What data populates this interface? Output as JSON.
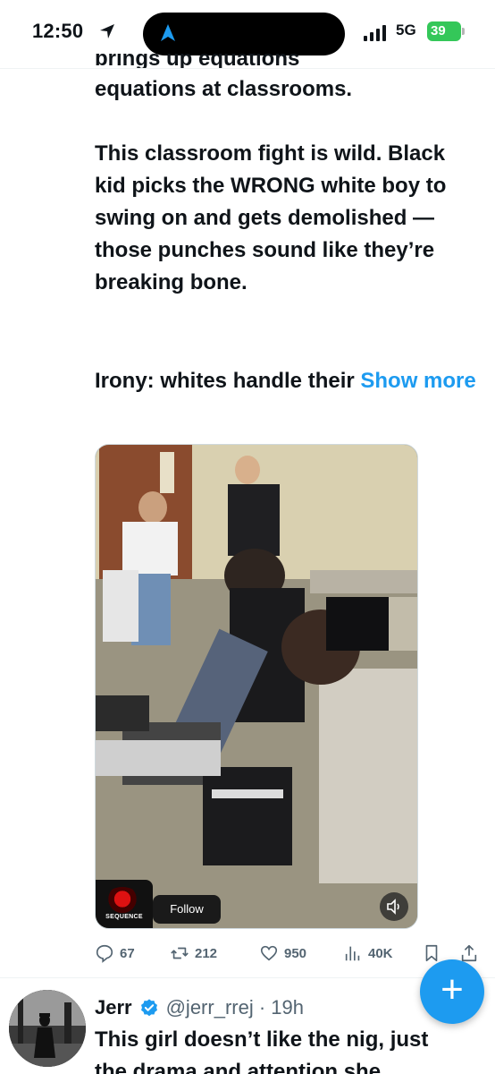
{
  "status_bar": {
    "time": "12:50",
    "network": "5G",
    "battery": "39"
  },
  "tweet": {
    "cut_line": "brings up equations",
    "paragraph1": "equations at classrooms.",
    "paragraph2": "This classroom fight is wild. Black kid picks the WRONG white boy to swing on and gets demolished — those punches sound like they’re breaking bone.",
    "paragraph3_start": "Irony: whites handle their ",
    "show_more": "Show more",
    "video": {
      "channel_name": "SEQUENCE",
      "follow_label": "Follow"
    },
    "actions": {
      "replies": "67",
      "reposts": "212",
      "likes": "950",
      "views": "40K"
    }
  },
  "next_tweet": {
    "name": "Jerr",
    "handle_time": "@jerr_rrej · 19h",
    "text_line1": "This girl doesn’t like the nig, just",
    "text_line2": "the drama and attention she"
  },
  "fab": {
    "label": "+"
  },
  "colors": {
    "accent": "#1d9bf0",
    "text": "#0f1419",
    "secondary": "#536471",
    "battery": "#34c759"
  }
}
